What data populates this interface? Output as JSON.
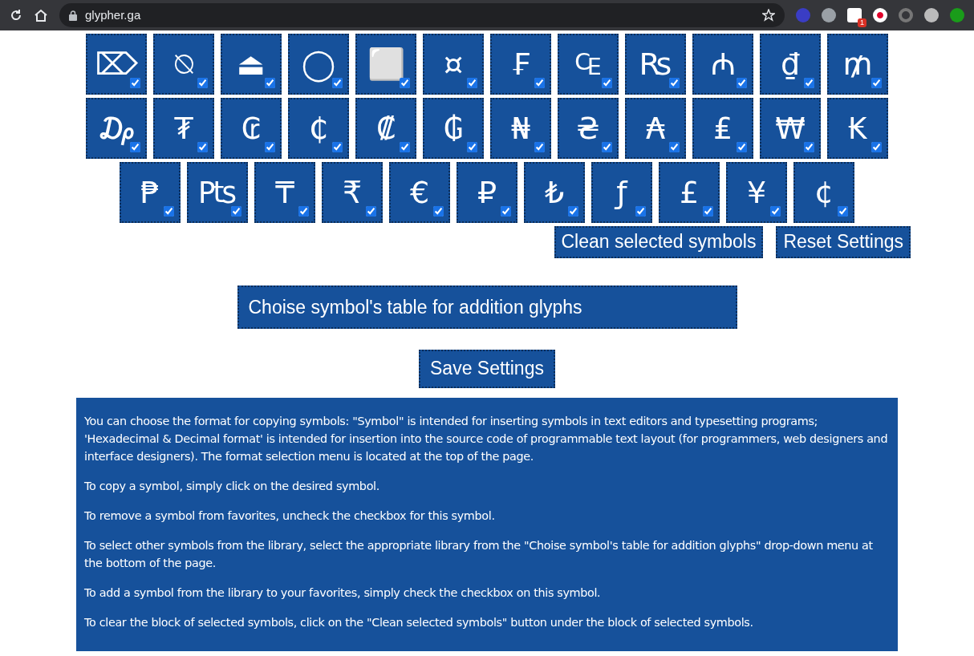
{
  "browser": {
    "url": "glypher.ga",
    "extension_badge": "1"
  },
  "symbol_rows": [
    [
      {
        "glyph": "⌦",
        "checked": true
      },
      {
        "glyph": "⍉",
        "checked": true
      },
      {
        "glyph": "⏏",
        "checked": true
      },
      {
        "glyph": "◯",
        "checked": true
      },
      {
        "glyph": "⬜",
        "checked": true
      },
      {
        "glyph": "¤",
        "checked": true
      },
      {
        "glyph": "₣",
        "checked": true
      },
      {
        "glyph": "₠",
        "checked": true
      },
      {
        "glyph": "₨",
        "checked": true
      },
      {
        "glyph": "₼",
        "checked": true
      },
      {
        "glyph": "₫",
        "checked": true
      },
      {
        "glyph": "₥",
        "checked": true
      }
    ],
    [
      {
        "glyph": "₯",
        "checked": true
      },
      {
        "glyph": "₮",
        "checked": true
      },
      {
        "glyph": "₢",
        "checked": true
      },
      {
        "glyph": "₵",
        "checked": true
      },
      {
        "glyph": "₡",
        "checked": true
      },
      {
        "glyph": "₲",
        "checked": true
      },
      {
        "glyph": "₦",
        "checked": true
      },
      {
        "glyph": "₴",
        "checked": true
      },
      {
        "glyph": "₳",
        "checked": true
      },
      {
        "glyph": "₤",
        "checked": true
      },
      {
        "glyph": "₩",
        "checked": true
      },
      {
        "glyph": "₭",
        "checked": true
      }
    ],
    [
      {
        "glyph": "₱",
        "checked": true
      },
      {
        "glyph": "₧",
        "checked": true
      },
      {
        "glyph": "₸",
        "checked": true
      },
      {
        "glyph": "₹",
        "checked": true
      },
      {
        "glyph": "€",
        "checked": true
      },
      {
        "glyph": "₽",
        "checked": true
      },
      {
        "glyph": "₺",
        "checked": true
      },
      {
        "glyph": "ƒ",
        "checked": true
      },
      {
        "glyph": "£",
        "checked": true
      },
      {
        "glyph": "¥",
        "checked": true
      },
      {
        "glyph": "¢",
        "checked": true
      }
    ]
  ],
  "actions": [
    "Clean selected symbols",
    "Reset Settings"
  ],
  "table_select": {
    "value": "Choise symbol's table for addition glyphs"
  },
  "save_button": "Save Settings",
  "info": [
    "You can choose the format for copying symbols: \"Symbol\" is intended for inserting symbols in text editors and typesetting programs; 'Hexadecimal & Decimal format' is intended for insertion into the source code of programmable text layout (for programmers, web designers and interface designers). The format selection menu is located at the top of the page.",
    "To copy a symbol, simply click on the desired symbol.",
    "To remove a symbol from favorites, uncheck the checkbox for this symbol.",
    "To select other symbols from the library, select the appropriate library from the \"Choise symbol's table for addition glyphs\" drop-down menu at the bottom of the page.",
    "To add a symbol from the library to your favorites, simply check the checkbox on this symbol.",
    "To clear the block of selected symbols, click on the \"Clean selected symbols\" button under the block of selected symbols."
  ]
}
